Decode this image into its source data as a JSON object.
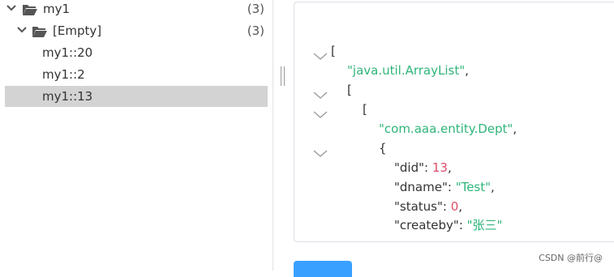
{
  "tree": {
    "root": {
      "label": "my1",
      "count": "(3)"
    },
    "group": {
      "label": "[Empty]",
      "count": "(3)"
    },
    "items": [
      {
        "label": "my1::20",
        "selected": false
      },
      {
        "label": "my1::2",
        "selected": false
      },
      {
        "label": "my1::13",
        "selected": true
      }
    ]
  },
  "json_viewer": {
    "lines": {
      "l1": "[",
      "l2": "\"java.util.ArrayList\"",
      "l2c": ",",
      "l3": "[",
      "l4": "[",
      "l5": "\"com.aaa.entity.Dept\"",
      "l5c": ",",
      "l6": "{",
      "did_key": "\"did\"",
      "did_val": "13",
      "dname_key": "\"dname\"",
      "dname_val": "\"Test\"",
      "status_key": "\"status\"",
      "status_val": "0",
      "createby_key": "\"createby\"",
      "createby_val": "\"张三\"",
      "colon": ": ",
      "comma": ","
    }
  },
  "watermark": "CSDN @前行@",
  "colors": {
    "string": "#2fb57a",
    "number": "#e04d6a",
    "selected_row": "#d3d3d3",
    "button": "#3aa0ff"
  }
}
